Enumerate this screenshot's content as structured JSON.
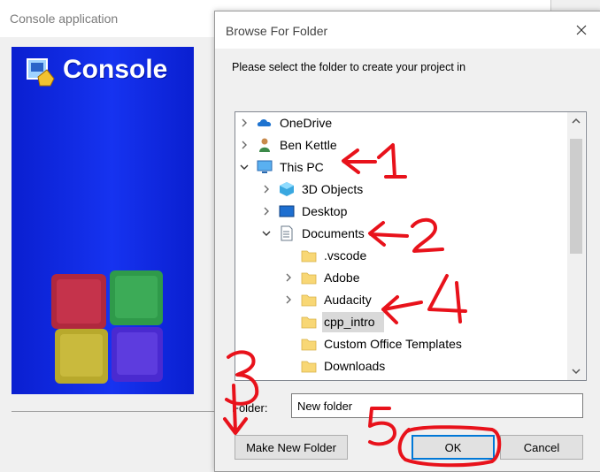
{
  "background_window": {
    "title": "Console application",
    "banner_text": "Console"
  },
  "dialog": {
    "title": "Browse For Folder",
    "prompt": "Please select the folder to create your project in",
    "folder_label": "Folder:",
    "folder_value": "New folder",
    "buttons": {
      "make_new_folder": "Make New Folder",
      "ok": "OK",
      "cancel": "Cancel"
    }
  },
  "tree": {
    "items": [
      {
        "label": "OneDrive",
        "icon": "cloud-icon",
        "expander": "collapsed",
        "level": 0
      },
      {
        "label": "Ben Kettle",
        "icon": "user-icon",
        "expander": "collapsed",
        "level": 0
      },
      {
        "label": "This PC",
        "icon": "computer-icon",
        "expander": "expanded",
        "level": 0
      },
      {
        "label": "3D Objects",
        "icon": "cube-icon",
        "expander": "collapsed",
        "level": 1
      },
      {
        "label": "Desktop",
        "icon": "desktop-icon",
        "expander": "collapsed",
        "level": 1
      },
      {
        "label": "Documents",
        "icon": "document-icon",
        "expander": "expanded",
        "level": 1
      },
      {
        "label": ".vscode",
        "icon": "folder-icon",
        "expander": "none",
        "level": 2
      },
      {
        "label": "Adobe",
        "icon": "folder-icon",
        "expander": "collapsed",
        "level": 2
      },
      {
        "label": "Audacity",
        "icon": "folder-icon",
        "expander": "collapsed",
        "level": 2
      },
      {
        "label": "cpp_intro",
        "icon": "folder-icon",
        "expander": "none",
        "level": 2,
        "selected": true
      },
      {
        "label": "Custom Office Templates",
        "icon": "folder-icon",
        "expander": "none",
        "level": 2
      },
      {
        "label": "Downloads",
        "icon": "folder-icon",
        "expander": "none",
        "level": 2
      }
    ]
  },
  "annotations": [
    "1",
    "2",
    "3",
    "4",
    "5"
  ],
  "colors": {
    "annotation": "#e8121b",
    "banner_blue": "#1633f0",
    "folder_yellow": "#f8d775",
    "ok_border": "#0078d7"
  }
}
